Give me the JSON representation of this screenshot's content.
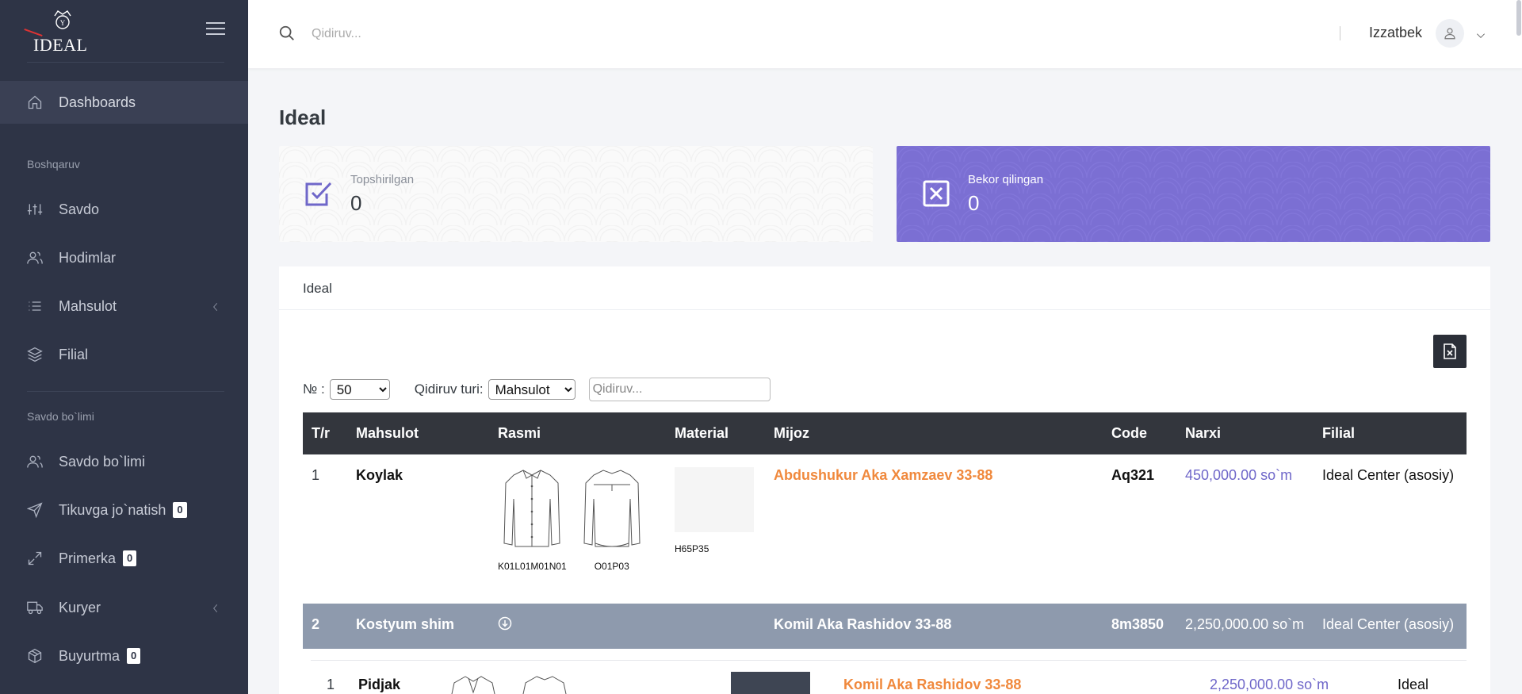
{
  "brand": {
    "logo_text": "IDEAL"
  },
  "topbar": {
    "search_placeholder": "Qidiruv...",
    "user_name": "Izzatbek"
  },
  "sidebar": {
    "items": [
      {
        "label": "Dashboards",
        "icon": "home-icon"
      },
      {
        "section": "Boshqaruv"
      },
      {
        "label": "Savdo",
        "icon": "sliders-icon"
      },
      {
        "label": "Hodimlar",
        "icon": "users-icon"
      },
      {
        "label": "Mahsulot",
        "icon": "list-icon"
      },
      {
        "label": "Filial",
        "icon": "layers-icon"
      },
      {
        "section": "Savdo bo`limi"
      },
      {
        "label": "Savdo bo`limi",
        "icon": "users-icon"
      },
      {
        "label": "Tikuvga jo`natish",
        "icon": "send-icon",
        "badge": "0"
      },
      {
        "label": "Primerka",
        "icon": "expand-icon",
        "badge": "0"
      },
      {
        "label": "Kuryer",
        "icon": "truck-icon"
      },
      {
        "label": "Buyurtma",
        "icon": "box-icon",
        "badge": "0"
      }
    ]
  },
  "page": {
    "title": "Ideal"
  },
  "stats": {
    "delivered": {
      "label": "Topshirilgan",
      "value": "0"
    },
    "cancelled": {
      "label": "Bekor qilingan",
      "value": "0"
    }
  },
  "panel": {
    "title": "Ideal",
    "filters": {
      "num_label": "№ :",
      "num_value": "50",
      "type_label": "Qidiruv turi:",
      "type_value": "Mahsulot",
      "search_placeholder": "Qidiruv..."
    },
    "table": {
      "headers": [
        "T/r",
        "Mahsulot",
        "Rasmi",
        "Material",
        "Mijoz",
        "Code",
        "Narxi",
        "Filial"
      ],
      "row1": {
        "num": "1",
        "product": "Koylak",
        "images": [
          "K01L01M01N01",
          "O01P03"
        ],
        "material": "H65P35",
        "customer": "Abdushukur Aka Xamzaev 33-88",
        "code": "Aq321",
        "price": "450,000.00 so`m",
        "branch": "Ideal Center (asosiy)"
      },
      "row2": {
        "num": "2",
        "product": "Kostyum shim",
        "customer": "Komil Aka Rashidov 33-88",
        "code": "8m3850",
        "price": "2,250,000.00 so`m",
        "branch": "Ideal Center (asosiy)"
      },
      "sub_row": {
        "num": "1",
        "product": "Pidjak",
        "customer": "Komil Aka Rashidov 33-88",
        "price": "2,250,000.00 so`m",
        "branch": "Ideal Center"
      }
    }
  },
  "colors": {
    "sidebar_bg": "#2e3446",
    "accent_purple": "#7b6fd3",
    "customer_orange": "#f0893d",
    "price_purple": "#6f67c9"
  }
}
